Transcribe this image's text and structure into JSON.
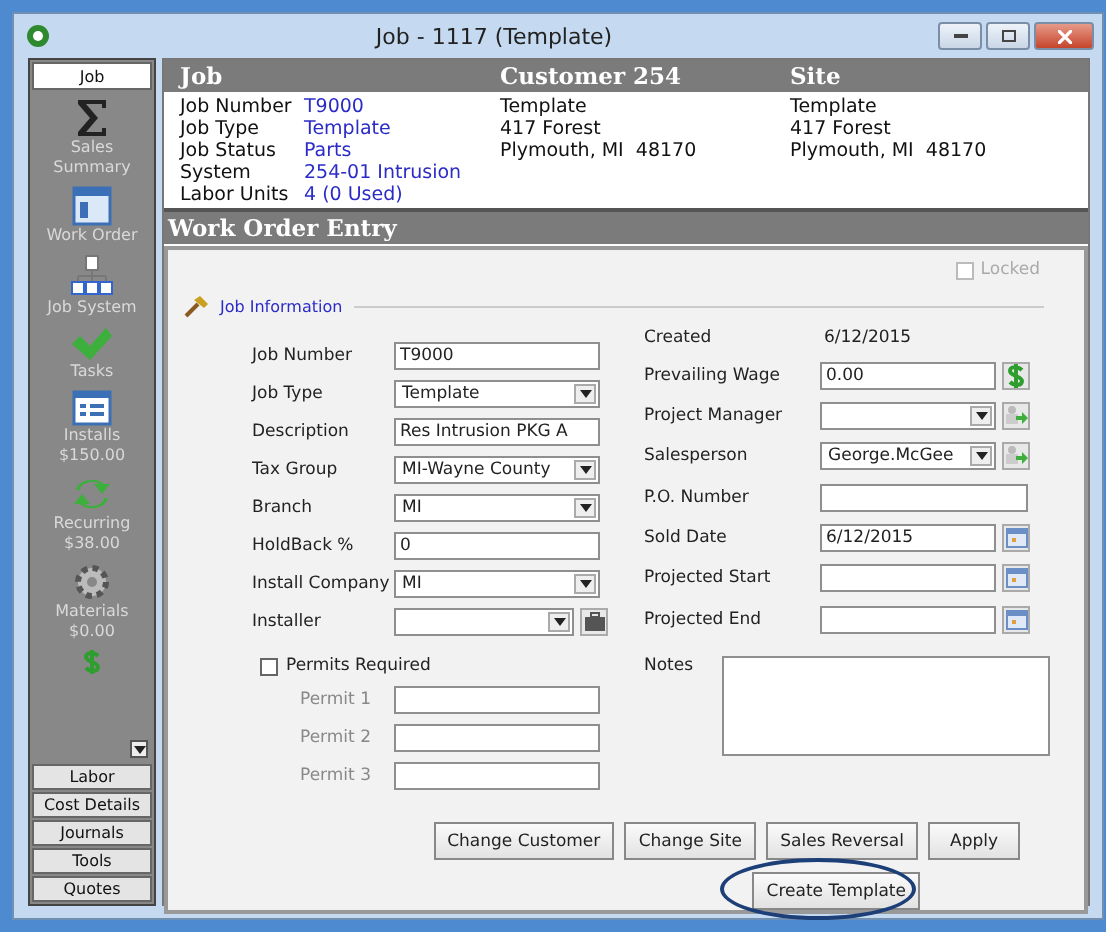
{
  "window": {
    "title": "Job - 1117 (Template)"
  },
  "sidebar": {
    "tabs": [
      {
        "label": "Job",
        "selected": true
      },
      {
        "label": "Labor",
        "selected": false
      },
      {
        "label": "Cost Details",
        "selected": false
      },
      {
        "label": "Journals",
        "selected": false
      },
      {
        "label": "Tools",
        "selected": false
      },
      {
        "label": "Quotes",
        "selected": false
      }
    ],
    "items": [
      {
        "label": "Sales Summary"
      },
      {
        "label": "Work Order"
      },
      {
        "label": "Job System"
      },
      {
        "label": "Tasks"
      },
      {
        "label": "Installs",
        "amount": "$150.00"
      },
      {
        "label": "Recurring",
        "amount": "$38.00"
      },
      {
        "label": "Materials",
        "amount": "$0.00"
      }
    ]
  },
  "header": {
    "job_title": "Job",
    "customer_title": "Customer 254",
    "site_title": "Site"
  },
  "job_info": [
    {
      "label": "Job Number",
      "value": "T9000"
    },
    {
      "label": "Job Type",
      "value": "Template"
    },
    {
      "label": "Job Status",
      "value": "Parts"
    },
    {
      "label": "System",
      "value": "254-01 Intrusion"
    },
    {
      "label": "Labor Units",
      "value": "4 (0 Used)"
    }
  ],
  "customer": [
    "Template",
    "417 Forest",
    "Plymouth, MI  48170"
  ],
  "site": [
    "Template",
    "417 Forest",
    "Plymouth, MI  48170"
  ],
  "section_title": "Work Order Entry",
  "locked": {
    "label": "Locked",
    "checked": false
  },
  "group_title": "Job Information",
  "left_fields": [
    {
      "label": "Job Number",
      "kind": "text",
      "value": "T9000"
    },
    {
      "label": "Job Type",
      "kind": "dropdown",
      "value": "Template"
    },
    {
      "label": "Description",
      "kind": "text",
      "value": "Res Intrusion PKG A"
    },
    {
      "label": "Tax Group",
      "kind": "dropdown",
      "value": "MI-Wayne County"
    },
    {
      "label": "Branch",
      "kind": "dropdown",
      "value": "MI"
    },
    {
      "label": "HoldBack  %",
      "kind": "text",
      "value": "0"
    },
    {
      "label": "Install Company",
      "kind": "dropdown",
      "value": "MI"
    },
    {
      "label": "Installer",
      "kind": "picker"
    }
  ],
  "right_fields": [
    {
      "label": "Created",
      "kind": "static",
      "value": "6/12/2015"
    },
    {
      "label": "Prevailing Wage",
      "kind": "money",
      "value": "0.00"
    },
    {
      "label": "Project Manager",
      "kind": "assign"
    },
    {
      "label": "Salesperson",
      "kind": "assign",
      "value": "George.McGee"
    },
    {
      "label": "P.O. Number",
      "kind": "text"
    },
    {
      "label": "Sold Date",
      "kind": "date",
      "value": "6/12/2015"
    },
    {
      "label": "Projected Start",
      "kind": "date"
    },
    {
      "label": "Projected End",
      "kind": "date"
    }
  ],
  "permits": {
    "label": "Permits Required",
    "checked": false,
    "items": [
      "Permit 1",
      "Permit 2",
      "Permit 3"
    ]
  },
  "notes": {
    "label": "Notes"
  },
  "buttons": [
    "Change Customer",
    "Change Site",
    "Sales Reversal",
    "Apply"
  ],
  "template_button": {
    "label": "Create Template",
    "highlighted": true
  }
}
